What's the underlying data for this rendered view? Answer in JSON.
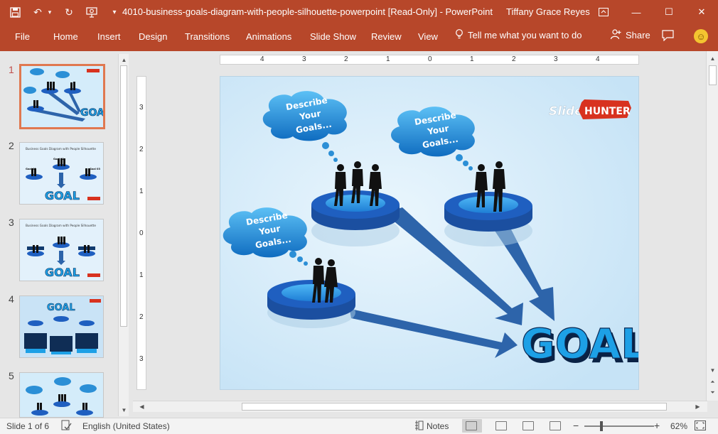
{
  "titlebar": {
    "title": "4010-business-goals-diagram-with-people-silhouette-powerpoint [Read-Only]  -  PowerPoint",
    "user": "Tiffany Grace Reyes",
    "save_icon": "save-icon",
    "undo_icon": "undo-icon",
    "redo_icon": "redo-icon",
    "present_icon": "present-from-start-icon",
    "customize_icon": "customize-qat-icon",
    "ribbon_display_icon": "ribbon-display-options-icon"
  },
  "ribbon": {
    "tabs": [
      "File",
      "Home",
      "Insert",
      "Design",
      "Transitions",
      "Animations",
      "Slide Show",
      "Review",
      "View"
    ],
    "tell_me": "Tell me what you want to do",
    "share": "Share",
    "accent": "#b7472a"
  },
  "thumbnails": [
    {
      "num": "1",
      "active": true
    },
    {
      "num": "2",
      "title": "Business Goals Diagram with People Silhouette",
      "labels": [
        "Goal 01",
        "Goal 02",
        "Goal 03"
      ],
      "goal": "GOAL"
    },
    {
      "num": "3",
      "title": "Business Goals Diagram with People Silhouette",
      "goal": "GOAL"
    },
    {
      "num": "4",
      "goal": "GOAL"
    },
    {
      "num": "5"
    }
  ],
  "slide": {
    "bubbles": [
      {
        "line1": "Describe",
        "line2": "Your",
        "line3": "Goals..."
      },
      {
        "line1": "Describe",
        "line2": "Your",
        "line3": "Goals..."
      },
      {
        "line1": "Describe",
        "line2": "Your",
        "line3": "Goals..."
      }
    ],
    "brand_slide": "Slide",
    "brand_hunter": "HUNTER",
    "goal_word": "GOAL",
    "colors": {
      "bg": "#d4ecfa",
      "platform": "#1f5fc0",
      "arrow": "#2d64aa",
      "goal": "#1da0e6"
    }
  },
  "ruler": {
    "h_marks": [
      "4",
      "3",
      "2",
      "1",
      "0",
      "1",
      "2",
      "3",
      "4"
    ],
    "v_marks": [
      "3",
      "2",
      "1",
      "0",
      "1",
      "2",
      "3"
    ]
  },
  "statusbar": {
    "slide_of": "Slide 1 of 6",
    "language": "English (United States)",
    "notes": "Notes",
    "zoom": "62%"
  }
}
